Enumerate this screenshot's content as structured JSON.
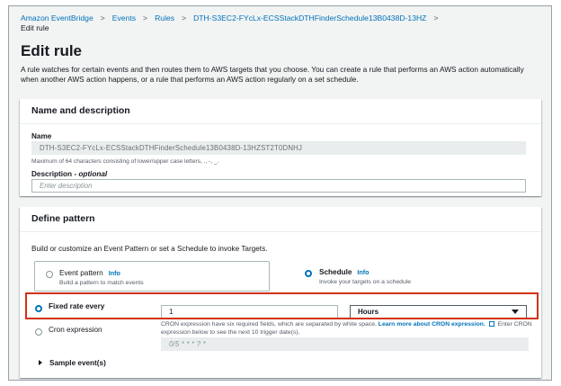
{
  "breadcrumbs": [
    {
      "label": "Amazon EventBridge"
    },
    {
      "label": "Events"
    },
    {
      "label": "Rules"
    },
    {
      "label": "DTH-S3EC2-FYcLx-ECSStackDTHFinderSchedule13B0438D-13HZ"
    }
  ],
  "breadcrumb_current": "Edit rule",
  "page_title": "Edit rule",
  "intro": "A rule watches for certain events and then routes them to AWS targets that you choose. You can create a rule that performs an AWS action automatically when another AWS action happens, or a rule that performs an AWS action regularly on a set schedule.",
  "name_section": {
    "heading": "Name and description",
    "name_label": "Name",
    "name_value": "DTH-S3EC2-FYcLx-ECSStackDTHFinderSchedule13B0438D-13HZST2T0DNHJ",
    "name_hint": "Maximum of 64 characters consisting of lower/upper case letters, ., -, _.",
    "description_label": "Description",
    "description_optional": "optional",
    "description_placeholder": "Enter description"
  },
  "pattern_section": {
    "heading": "Define pattern",
    "prompt": "Build or customize an Event Pattern or set a Schedule to invoke Targets.",
    "event_pattern": {
      "label": "Event pattern",
      "info": "Info",
      "sub": "Build a pattern to match events",
      "selected": false
    },
    "schedule": {
      "label": "Schedule",
      "info": "Info",
      "sub": "Invoke your targets on a schedule",
      "selected": true
    },
    "fixed_rate": {
      "label": "Fixed rate every",
      "value": "1",
      "unit": "Hours",
      "selected": true
    },
    "cron": {
      "label": "Cron expression",
      "desc_part1": "CRON expression have six required fields, which are separated by white space.",
      "learn_more": "Learn more about CRON expression.",
      "desc_part2": "Enter CRON expression below to see the next 10 trigger date(s).",
      "placeholder": "0/5 * * * ? *",
      "selected": false
    },
    "sample_events": "Sample event(s)"
  },
  "colors": {
    "link": "#0073bb",
    "highlight_border": "#d13212",
    "background": "#f2f3f3"
  }
}
